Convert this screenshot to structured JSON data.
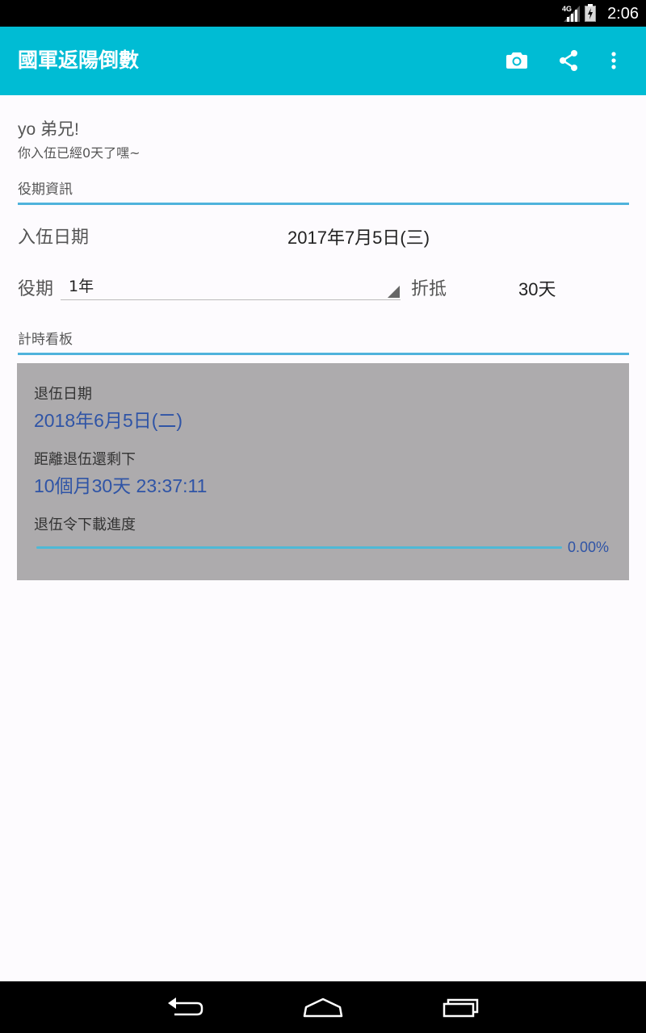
{
  "status_bar": {
    "network": "4G",
    "time": "2:06",
    "icons": [
      "signal-icon",
      "battery-icon"
    ]
  },
  "app_bar": {
    "title": "國軍返陽倒數",
    "actions": [
      "camera-icon",
      "share-icon",
      "overflow-menu-icon"
    ],
    "color": "#00bcd4"
  },
  "greeting": {
    "title": "yo 弟兄!",
    "subtitle": "你入伍已經0天了嘿~"
  },
  "service_info": {
    "header": "役期資訊",
    "enlist_label": "入伍日期",
    "enlist_date": "2017年7月5日(三)",
    "term_label": "役期",
    "term_value": "1年",
    "deduction_label": "折抵",
    "deduction_value": "30天"
  },
  "timer_board": {
    "header": "計時看板",
    "discharge_label": "退伍日期",
    "discharge_date": "2018年6月5日(二)",
    "remaining_label": "距離退伍還剩下",
    "remaining_value": "10個月30天 23:37:11",
    "progress_label": "退伍令下載進度",
    "progress_text": "0.00%",
    "progress_fraction": 0.0
  },
  "nav_bar": {
    "buttons": [
      "back-icon",
      "home-icon",
      "recents-icon"
    ]
  }
}
